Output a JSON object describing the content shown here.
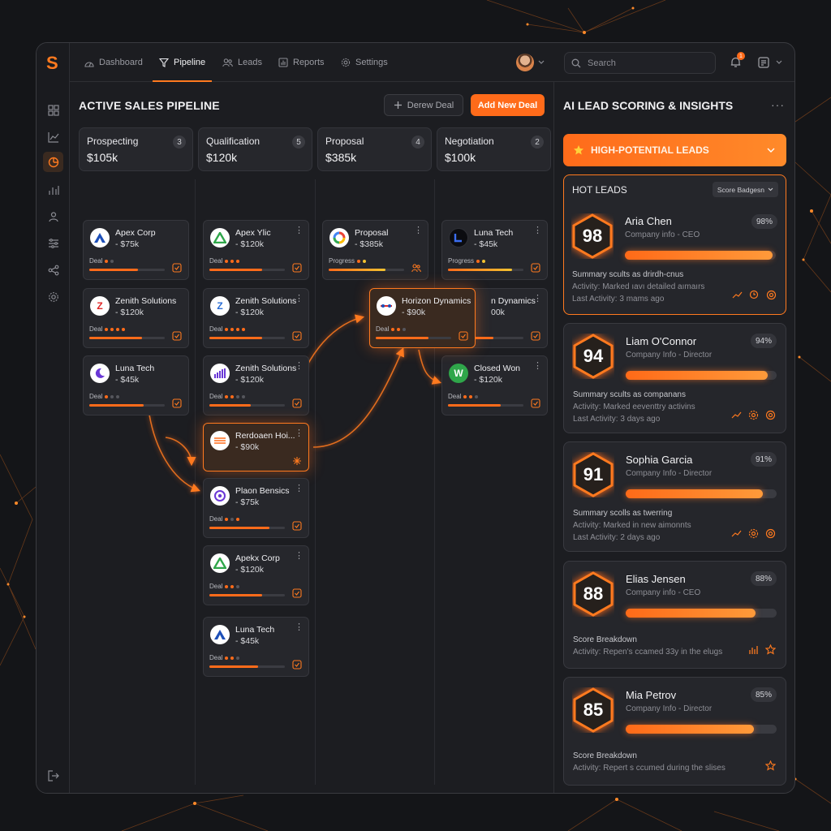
{
  "app": {
    "logo": "S"
  },
  "nav": {
    "tabs": [
      {
        "label": "Dashboard"
      },
      {
        "label": "Pipeline"
      },
      {
        "label": "Leads"
      },
      {
        "label": "Reports"
      },
      {
        "label": "Settings"
      }
    ],
    "active_tab": "Pipeline",
    "search_placeholder": "Search",
    "notification_count": "1"
  },
  "sidebar": {
    "items": [
      "grid-icon",
      "trend-icon",
      "pie-icon",
      "bar-chart-icon",
      "users-icon",
      "sliders-icon",
      "share-icon",
      "gear-icon"
    ],
    "bottom": "logout-icon",
    "active": "pie-icon"
  },
  "pipeline": {
    "title": "ACTIVE SALES PIPELINE",
    "secondary_button": "Derew Deal",
    "primary_button": "Add New Deal",
    "columns": [
      {
        "name": "Prospecting",
        "value": "$105k",
        "count": "3",
        "cards": [
          {
            "name": "Apex Corp",
            "amount": "- $75k",
            "tag": "Deal",
            "progress": 0.65
          },
          {
            "name": "Zenith Solutions",
            "amount": "- $120k",
            "tag": "Deal",
            "progress": 0.7
          },
          {
            "name": "Luna Tech",
            "amount": "- $45k",
            "tag": "Deal",
            "progress": 0.72
          }
        ]
      },
      {
        "name": "Qualification",
        "value": "$120k",
        "count": "5",
        "cards": [
          {
            "name": "Apex Ylic",
            "amount": "- $120k",
            "tag": "Deal",
            "progress": 0.7
          },
          {
            "name": "Zenith Solutions",
            "amount": "- $120k",
            "tag": "Deal",
            "progress": 0.7
          },
          {
            "name": "Zenith Solutions",
            "amount": "- $120k",
            "tag": "Deal",
            "progress": 0.55
          },
          {
            "name": "Rerdoaen Hoi...",
            "amount": "- $90k",
            "tag": "",
            "progress": 0
          },
          {
            "name": "Plaon Bensics",
            "amount": "- $75k",
            "tag": "Deal",
            "progress": 0.8
          },
          {
            "name": "Apekx Corp",
            "amount": "- $120k",
            "tag": "Deal",
            "progress": 0.7
          },
          {
            "name": "Luna Tech",
            "amount": "- $45k",
            "tag": "Deal",
            "progress": 0.65
          }
        ]
      },
      {
        "name": "Proposal",
        "value": "$385k",
        "count": "4",
        "cards": [
          {
            "name": "Proposal",
            "amount": "- $385k",
            "tag": "Progress",
            "progress": 0.75
          },
          {
            "name": "Horizon Dynamics",
            "amount": "- $90k",
            "tag": "Deal",
            "progress": 0.7
          }
        ]
      },
      {
        "name": "Negotiation",
        "value": "$100k",
        "count": "2",
        "cards": [
          {
            "name": "Luna Tech",
            "amount": "- $45k",
            "tag": "Progress",
            "progress": 0.85
          },
          {
            "name": "n Dynamics",
            "amount": "00k",
            "tag": "",
            "progress": 0.6
          },
          {
            "name": "Closed Won",
            "amount": "- $120k",
            "tag": "Deal",
            "progress": 0.7
          }
        ]
      }
    ]
  },
  "insights": {
    "title": "AI LEAD SCORING & INSIGHTS",
    "banner": "HIGH-POTENTIAL LEADS",
    "hot_leads_title": "HOT LEADS",
    "badge_select": "Score Badgesn",
    "leads": [
      {
        "score": "98",
        "name": "Aria Chen",
        "sub": "Company info - CEO",
        "pct": "98%",
        "bar": 0.98,
        "lines": [
          "Summary scults as drirdh-cnus",
          "Activity: Marked ıavı detailed aımaırs",
          "Last Activity: 3 mams ago"
        ]
      },
      {
        "score": "94",
        "name": "Liam O'Connor",
        "sub": "Company Info - Director",
        "pct": "94%",
        "bar": 0.94,
        "lines": [
          "Summary scults as companans",
          "Activity: Marked eeventtry activins",
          "Last Activity: 3 days ago"
        ]
      },
      {
        "score": "91",
        "name": "Sophia Garcia",
        "sub": "Company Info - Director",
        "pct": "91%",
        "bar": 0.91,
        "lines": [
          "Summary scolls as twerring",
          "Activity: Marked in new aimonnts",
          "Last Activity: 2 days ago"
        ]
      },
      {
        "score": "88",
        "name": "Elias Jensen",
        "sub": "Company info - CEO",
        "pct": "88%",
        "bar": 0.86,
        "lines": [
          "Score Breakdown",
          "Activity: Repen's ccamed 33y in the elugs"
        ]
      },
      {
        "score": "85",
        "name": "Mia Petrov",
        "sub": "Company Info - Director",
        "pct": "85%",
        "bar": 0.85,
        "lines": [
          "Score Breakdown",
          "Activity: Repert s ccumed during the slises"
        ]
      }
    ]
  },
  "colors": {
    "accent": "#ff6b1a",
    "background": "#141518",
    "panel": "#1c1d21",
    "card": "#26272c"
  }
}
